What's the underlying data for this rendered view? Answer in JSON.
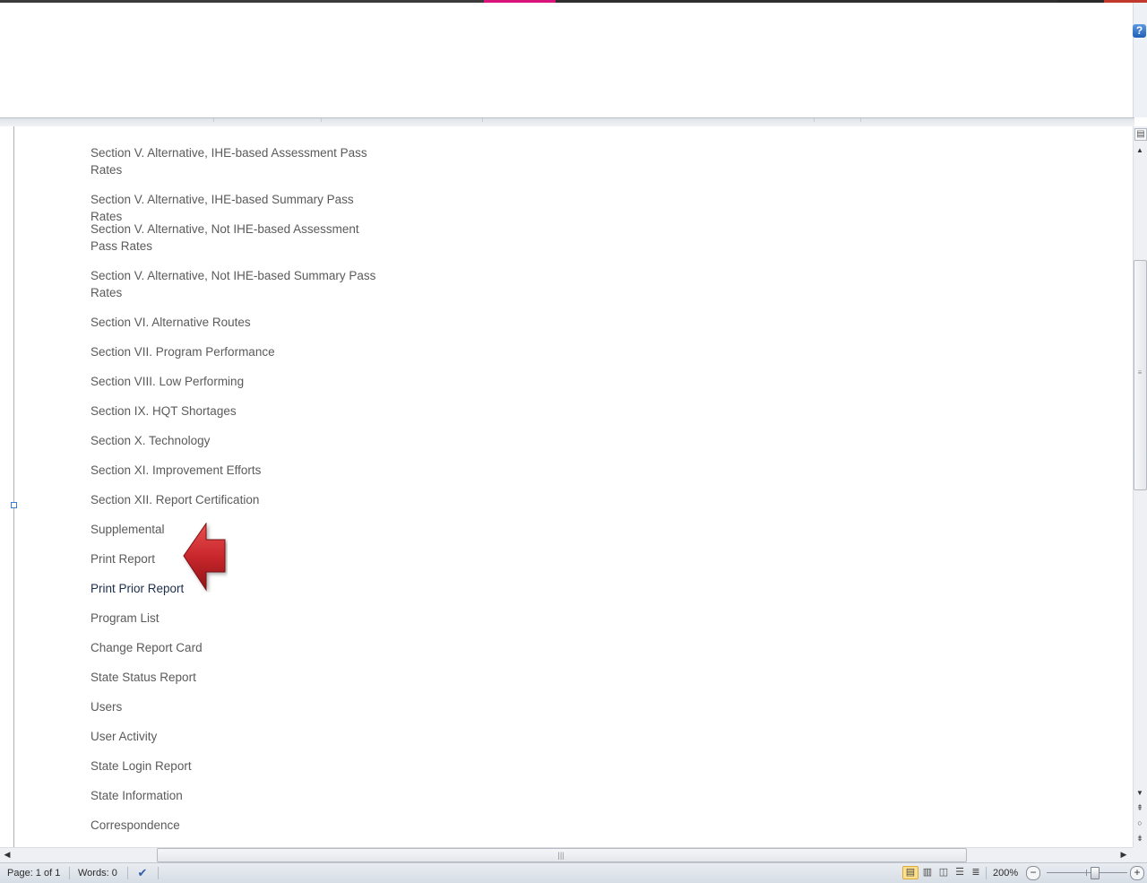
{
  "nav": {
    "items": [
      {
        "label": "Section V. Alternative, IHE-based Assessment Pass Rates",
        "style": "normal"
      },
      {
        "label": "Section V. Alternative, IHE-based Summary Pass Rates",
        "style": "normal"
      },
      {
        "label": "Section V. Alternative, Not IHE-based Assessment Pass Rates",
        "style": "normal"
      },
      {
        "label": "Section V. Alternative, Not IHE-based Summary Pass Rates",
        "style": "normal"
      },
      {
        "label": "Section VI. Alternative Routes",
        "style": "normal"
      },
      {
        "label": "Section VII. Program Performance",
        "style": "normal"
      },
      {
        "label": "Section VIII. Low Performing",
        "style": "normal"
      },
      {
        "label": "Section IX. HQT Shortages",
        "style": "normal"
      },
      {
        "label": "Section X. Technology",
        "style": "normal"
      },
      {
        "label": "Section XI. Improvement Efforts",
        "style": "normal"
      },
      {
        "label": "Section XII. Report Certification",
        "style": "normal"
      },
      {
        "label": "Supplemental",
        "style": "normal"
      },
      {
        "label": "Print Report",
        "style": "normal"
      },
      {
        "label": "Print Prior Report",
        "style": "dark"
      },
      {
        "label": "Program List",
        "style": "normal"
      },
      {
        "label": "Change Report Card",
        "style": "normal"
      },
      {
        "label": "State Status Report",
        "style": "normal"
      },
      {
        "label": "Users",
        "style": "normal"
      },
      {
        "label": "User Activity",
        "style": "normal"
      },
      {
        "label": "State Login Report",
        "style": "normal"
      },
      {
        "label": "State Information",
        "style": "normal"
      },
      {
        "label": "Correspondence",
        "style": "normal"
      }
    ]
  },
  "ribbon": {
    "help_glyph": "?"
  },
  "statusbar": {
    "page": "Page: 1 of 1",
    "words": "Words: 0",
    "zoom": "200%",
    "zoom_out_glyph": "−",
    "zoom_in_glyph": "+",
    "zoom_level_percent": 200
  },
  "icons": {
    "arrow": "red-left-arrow-callout",
    "proofing": "proofing-check-icon",
    "views": [
      "print-layout-icon",
      "full-screen-reading-icon",
      "web-layout-icon",
      "outline-icon",
      "draft-icon"
    ]
  },
  "colors": {
    "arrow": "#c8262b",
    "link_text": "#5a5a5a",
    "link_text_dark": "#1d2e4a",
    "help_blue": "#1f5fb8",
    "title_pink": "#d8137a"
  }
}
